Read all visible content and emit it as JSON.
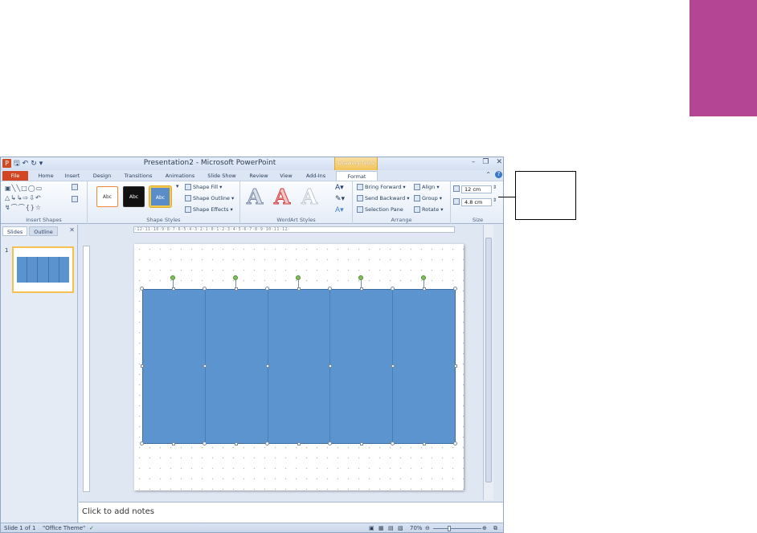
{
  "window": {
    "title": "Presentation2 - Microsoft PowerPoint",
    "contextual_tab_group": "Drawing Tools"
  },
  "tabs": [
    "File",
    "Home",
    "Insert",
    "Design",
    "Transitions",
    "Animations",
    "Slide Show",
    "Review",
    "View",
    "Add-Ins",
    "Format"
  ],
  "active_tab": "Format",
  "ribbon": {
    "insert_shapes": {
      "label": "Insert Shapes"
    },
    "shape_styles": {
      "label": "Shape Styles",
      "swatch_labels": [
        "Abc",
        "Abc",
        "Abc"
      ],
      "shape_fill": "Shape Fill",
      "shape_outline": "Shape Outline",
      "shape_effects": "Shape Effects"
    },
    "wordart_styles": {
      "label": "WordArt Styles",
      "glyph": "A"
    },
    "arrange": {
      "label": "Arrange",
      "bring_forward": "Bring Forward",
      "send_backward": "Send Backward",
      "selection_pane": "Selection Pane",
      "align": "Align",
      "group": "Group",
      "rotate": "Rotate"
    },
    "size": {
      "label": "Size",
      "height": "12 cm",
      "width": "4.8 cm"
    }
  },
  "left_pane": {
    "tab_slides": "Slides",
    "tab_outline": "Outline",
    "slide_number": "1"
  },
  "notes": {
    "placeholder": "Click to add notes"
  },
  "status": {
    "slide": "Slide 1 of 1",
    "theme": "\"Office Theme\"",
    "zoom": "70%"
  },
  "colors": {
    "shape_fill": "#5b94cf",
    "accent_magenta": "#b44595",
    "file_tab": "#d24624"
  }
}
